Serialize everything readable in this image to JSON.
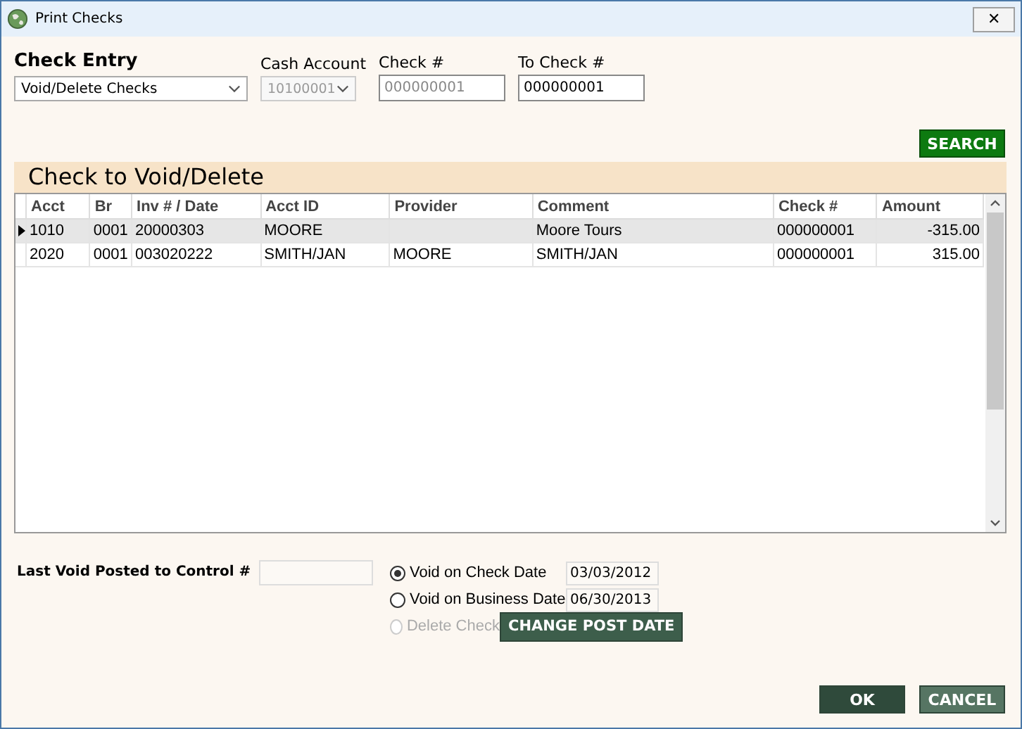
{
  "window": {
    "title": "Print Checks",
    "close": "✕"
  },
  "check_entry": {
    "title": "Check Entry",
    "mode": {
      "value": "Void/Delete Checks"
    },
    "fields": [
      {
        "label": "Cash Account",
        "kind": "dropdown",
        "value": "10100001",
        "disabled": true
      },
      {
        "label": "Check #",
        "kind": "text",
        "value": "000000001",
        "disabled": true
      },
      {
        "label": "To Check #",
        "kind": "text",
        "value": "000000001",
        "disabled": false
      }
    ]
  },
  "search_button": "SEARCH",
  "grid": {
    "title": "Check to Void/Delete",
    "columns": [
      "Acct",
      "Br",
      "Inv # / Date",
      "Acct ID",
      "Provider",
      "Comment",
      "Check #",
      "Amount"
    ],
    "rows": [
      {
        "selected": true,
        "cells": [
          "1010",
          "0001",
          "20000303",
          "MOORE",
          "",
          "Moore Tours",
          "000000001",
          "-315.00"
        ]
      },
      {
        "selected": false,
        "cells": [
          "2020",
          "0001",
          "003020222",
          "SMITH/JAN",
          "MOORE",
          "SMITH/JAN",
          "000000001",
          "315.00"
        ]
      }
    ]
  },
  "last_void": {
    "label": "Last Void Posted to Control #"
  },
  "options": [
    {
      "label": "Void on Check Date",
      "selected": true,
      "disabled": false,
      "date": "03/03/2012"
    },
    {
      "label": "Void on Business Date",
      "selected": false,
      "disabled": false,
      "date": "06/30/2013"
    },
    {
      "label": "Delete Check",
      "selected": false,
      "disabled": true
    }
  ],
  "change_post_date": "CHANGE POST DATE",
  "buttons": [
    {
      "label": "OK",
      "kind": "primary"
    },
    {
      "label": "CANCEL",
      "kind": "secondary"
    }
  ]
}
